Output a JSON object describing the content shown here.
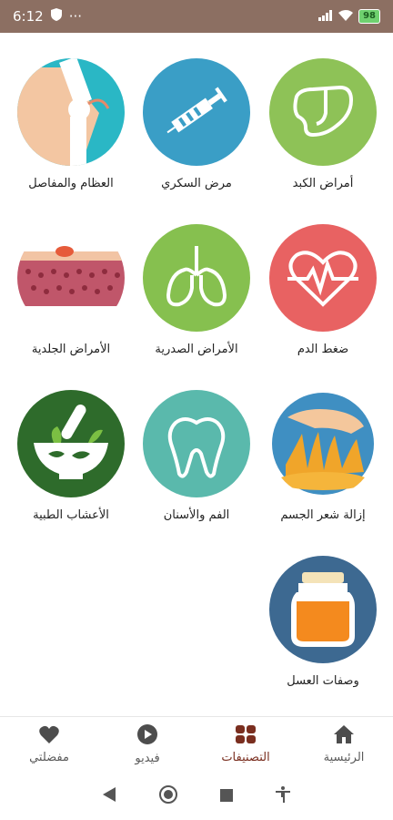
{
  "status": {
    "time": "6:12",
    "battery": "98"
  },
  "categories": [
    {
      "label": "أمراض الكبد",
      "icon": "liver-icon",
      "color": "#8ec257"
    },
    {
      "label": "مرض السكري",
      "icon": "syringe-icon",
      "color": "#3a9ec6"
    },
    {
      "label": "العظام والمفاصل",
      "icon": "knee-joint-icon",
      "color": "#2ab7c5"
    },
    {
      "label": "ضغط الدم",
      "icon": "heartbeat-icon",
      "color": "#e86262"
    },
    {
      "label": "الأمراض الصدرية",
      "icon": "lungs-icon",
      "color": "#86c04f"
    },
    {
      "label": "الأمراض الجلدية",
      "icon": "skin-layer-icon",
      "color": "#c0566a"
    },
    {
      "label": "إزالة شعر الجسم",
      "icon": "wax-hand-icon",
      "color": "#f0a52a"
    },
    {
      "label": "الفم والأسنان",
      "icon": "tooth-icon",
      "color": "#5ab9ac"
    },
    {
      "label": "الأعشاب الطبية",
      "icon": "mortar-pestle-icon",
      "color": "#2e6b2b"
    },
    {
      "label": "وصفات العسل",
      "icon": "honey-jar-icon",
      "color": "#3d6991"
    }
  ],
  "nav": [
    {
      "label": "الرئيسية",
      "icon": "home-icon"
    },
    {
      "label": "التصنيفات",
      "icon": "grid-icon",
      "active": true
    },
    {
      "label": "فيديو",
      "icon": "play-icon"
    },
    {
      "label": "مفضلتي",
      "icon": "heart-icon"
    }
  ],
  "accent": "#7a2e1f",
  "status_bar_color": "#8c6f62"
}
